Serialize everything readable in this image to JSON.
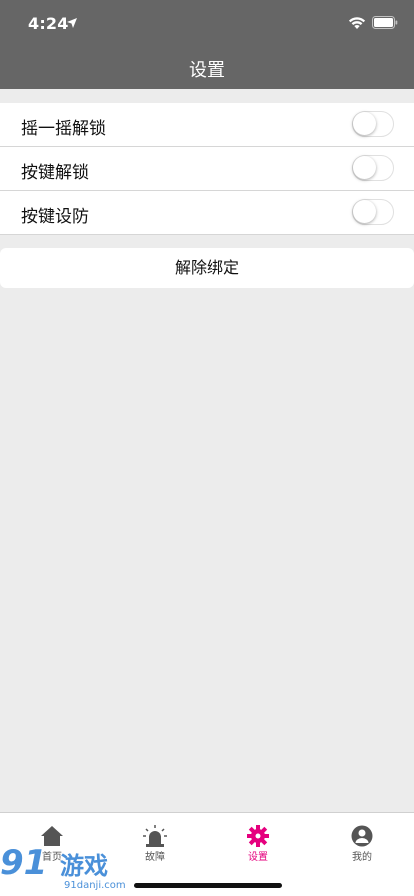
{
  "status_bar": {
    "time": "4:24"
  },
  "nav": {
    "title": "设置"
  },
  "settings": [
    {
      "label": "摇一摇解锁",
      "enabled": false
    },
    {
      "label": "按键解锁",
      "enabled": false
    },
    {
      "label": "按键设防",
      "enabled": false
    }
  ],
  "unbind_label": "解除绑定",
  "tabs": [
    {
      "label": "首页",
      "icon": "home-icon"
    },
    {
      "label": "故障",
      "icon": "alarm-icon"
    },
    {
      "label": "设置",
      "icon": "gear-icon",
      "active": true
    },
    {
      "label": "我的",
      "icon": "user-icon"
    }
  ],
  "watermark": {
    "logo": "91游戏",
    "url": "91danji.com"
  },
  "colors": {
    "header": "#666666",
    "accent": "#e5007e",
    "background": "#ececec"
  }
}
